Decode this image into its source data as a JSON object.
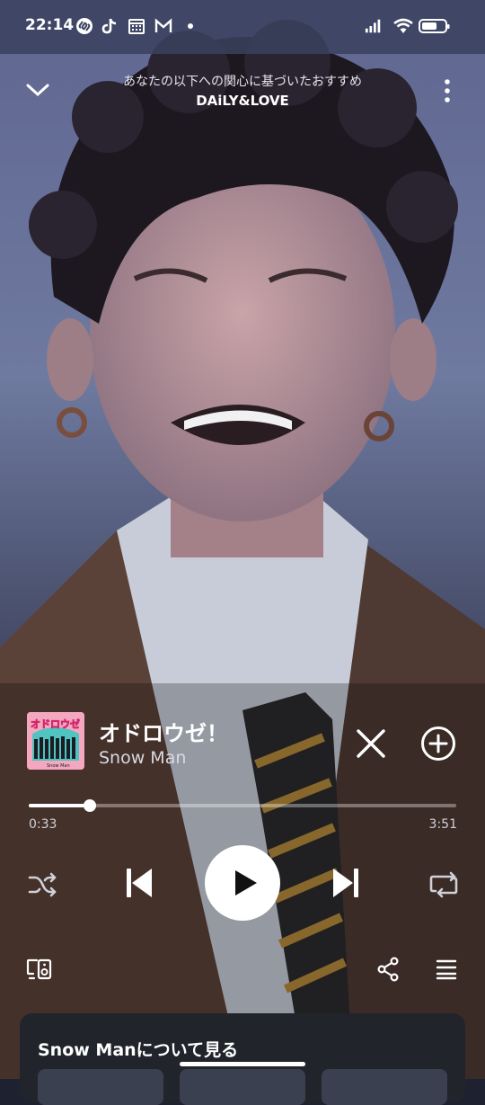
{
  "status_bar": {
    "time": "22:14",
    "app_icons": [
      "shazam-icon",
      "tiktok-icon",
      "calendar-icon",
      "gmail-icon",
      "dot-icon"
    ],
    "system_icons": [
      "signal-icon",
      "wifi-icon",
      "battery-icon"
    ]
  },
  "header": {
    "subtitle": "あなたの以下への関心に基づいたおすすめ",
    "title": "DAiLY&LOVE"
  },
  "track": {
    "title": "オドロウゼ！",
    "artist": "Snow Man",
    "cover_text": "オドロウゼ",
    "cover_label": "Snow Man"
  },
  "playback": {
    "current_time": "0:33",
    "total_time": "3:51",
    "progress": 0.143
  },
  "about": {
    "label": "Snow Manについて見る"
  },
  "colors": {
    "accent": "#ffffff",
    "cover_pink": "#f4a8c0",
    "cover_teal": "#4fc4c0",
    "card_bg": "#22242c"
  }
}
